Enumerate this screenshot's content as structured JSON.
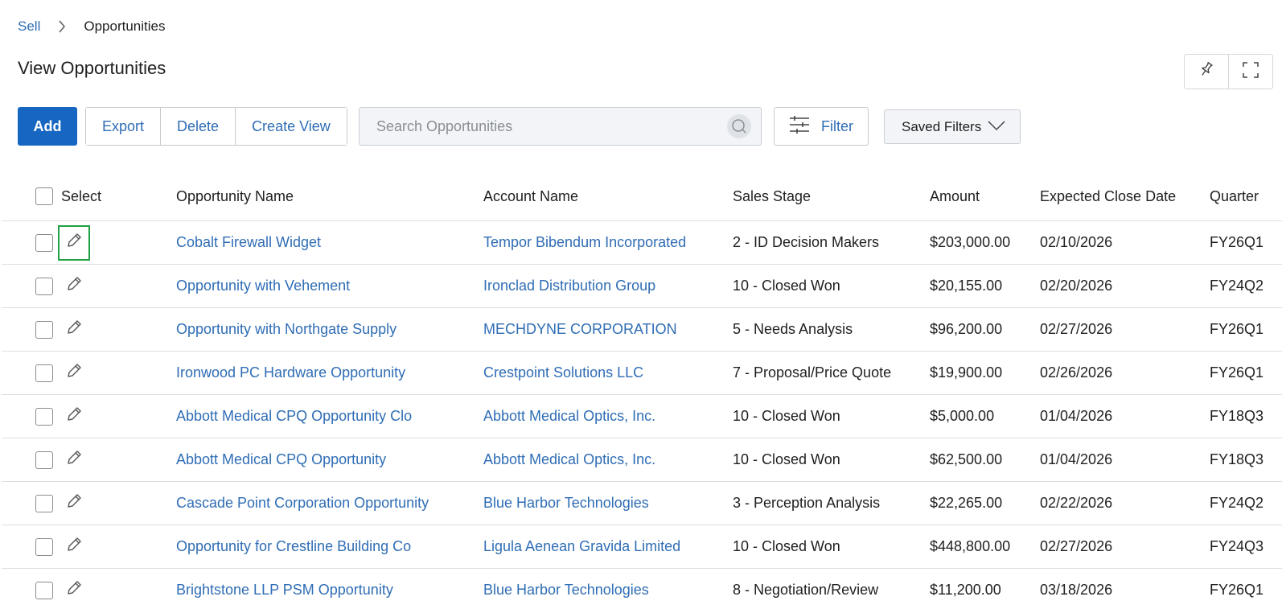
{
  "breadcrumb": {
    "parent": "Sell",
    "current": "Opportunities"
  },
  "page_title": "View Opportunities",
  "toolbar": {
    "add_label": "Add",
    "export_label": "Export",
    "delete_label": "Delete",
    "create_view_label": "Create View",
    "filter_label": "Filter",
    "saved_filters_label": "Saved Filters"
  },
  "search": {
    "placeholder": "Search Opportunities",
    "value": ""
  },
  "table": {
    "headers": {
      "select": "Select",
      "name": "Opportunity Name",
      "account": "Account Name",
      "stage": "Sales Stage",
      "amount": "Amount",
      "close_date": "Expected Close Date",
      "quarter": "Quarter"
    },
    "rows": [
      {
        "name": "Cobalt Firewall Widget",
        "account": "Tempor Bibendum Incorporated",
        "stage": "2 - ID Decision Makers",
        "amount": "$203,000.00",
        "close_date": "02/10/2026",
        "quarter": "FY26Q1"
      },
      {
        "name": "Opportunity with Vehement",
        "account": "Ironclad Distribution Group",
        "stage": "10 - Closed Won",
        "amount": "$20,155.00",
        "close_date": "02/20/2026",
        "quarter": "FY24Q2"
      },
      {
        "name": "Opportunity with Northgate Supply",
        "account": "MECHDYNE CORPORATION",
        "stage": "5 - Needs Analysis",
        "amount": "$96,200.00",
        "close_date": "02/27/2026",
        "quarter": "FY26Q1"
      },
      {
        "name": "Ironwood PC Hardware Opportunity",
        "account": "Crestpoint Solutions LLC",
        "stage": "7 - Proposal/Price Quote",
        "amount": "$19,900.00",
        "close_date": "02/26/2026",
        "quarter": "FY26Q1"
      },
      {
        "name": "Abbott Medical CPQ Opportunity Clo",
        "account": "Abbott Medical Optics, Inc.",
        "stage": "10 - Closed Won",
        "amount": "$5,000.00",
        "close_date": "01/04/2026",
        "quarter": "FY18Q3"
      },
      {
        "name": "Abbott Medical CPQ Opportunity",
        "account": "Abbott Medical Optics, Inc.",
        "stage": "10 - Closed Won",
        "amount": "$62,500.00",
        "close_date": "01/04/2026",
        "quarter": "FY18Q3"
      },
      {
        "name": "Cascade Point Corporation Opportunity",
        "account": "Blue Harbor Technologies",
        "stage": "3 - Perception Analysis",
        "amount": "$22,265.00",
        "close_date": "02/22/2026",
        "quarter": "FY24Q2"
      },
      {
        "name": "Opportunity for Crestline Building Co",
        "account": "Ligula Aenean Gravida Limited",
        "stage": "10 - Closed Won",
        "amount": "$448,800.00",
        "close_date": "02/27/2026",
        "quarter": "FY24Q3"
      },
      {
        "name": "Brightstone LLP PSM Opportunity",
        "account": "Blue Harbor Technologies",
        "stage": "8 - Negotiation/Review",
        "amount": "$11,200.00",
        "close_date": "03/18/2026",
        "quarter": "FY26Q1"
      }
    ]
  }
}
